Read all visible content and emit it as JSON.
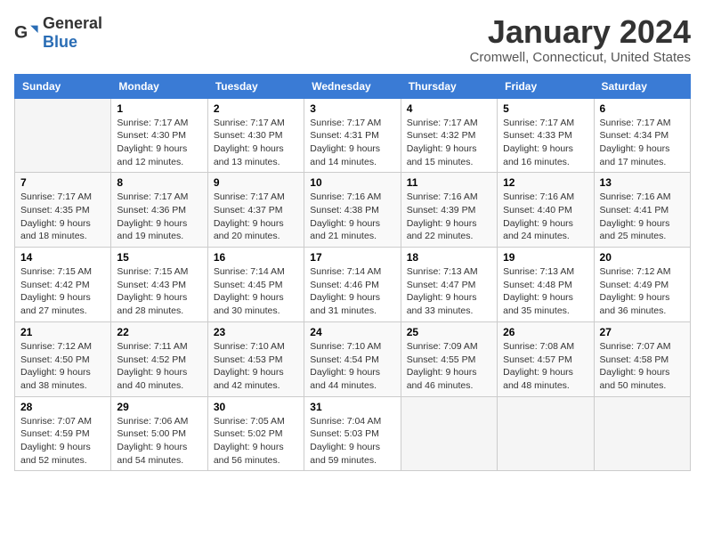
{
  "logo": {
    "text_general": "General",
    "text_blue": "Blue"
  },
  "title": "January 2024",
  "subtitle": "Cromwell, Connecticut, United States",
  "days_of_week": [
    "Sunday",
    "Monday",
    "Tuesday",
    "Wednesday",
    "Thursday",
    "Friday",
    "Saturday"
  ],
  "weeks": [
    [
      {
        "day": "",
        "info": ""
      },
      {
        "day": "1",
        "info": "Sunrise: 7:17 AM\nSunset: 4:30 PM\nDaylight: 9 hours\nand 12 minutes."
      },
      {
        "day": "2",
        "info": "Sunrise: 7:17 AM\nSunset: 4:30 PM\nDaylight: 9 hours\nand 13 minutes."
      },
      {
        "day": "3",
        "info": "Sunrise: 7:17 AM\nSunset: 4:31 PM\nDaylight: 9 hours\nand 14 minutes."
      },
      {
        "day": "4",
        "info": "Sunrise: 7:17 AM\nSunset: 4:32 PM\nDaylight: 9 hours\nand 15 minutes."
      },
      {
        "day": "5",
        "info": "Sunrise: 7:17 AM\nSunset: 4:33 PM\nDaylight: 9 hours\nand 16 minutes."
      },
      {
        "day": "6",
        "info": "Sunrise: 7:17 AM\nSunset: 4:34 PM\nDaylight: 9 hours\nand 17 minutes."
      }
    ],
    [
      {
        "day": "7",
        "info": "Sunrise: 7:17 AM\nSunset: 4:35 PM\nDaylight: 9 hours\nand 18 minutes."
      },
      {
        "day": "8",
        "info": "Sunrise: 7:17 AM\nSunset: 4:36 PM\nDaylight: 9 hours\nand 19 minutes."
      },
      {
        "day": "9",
        "info": "Sunrise: 7:17 AM\nSunset: 4:37 PM\nDaylight: 9 hours\nand 20 minutes."
      },
      {
        "day": "10",
        "info": "Sunrise: 7:16 AM\nSunset: 4:38 PM\nDaylight: 9 hours\nand 21 minutes."
      },
      {
        "day": "11",
        "info": "Sunrise: 7:16 AM\nSunset: 4:39 PM\nDaylight: 9 hours\nand 22 minutes."
      },
      {
        "day": "12",
        "info": "Sunrise: 7:16 AM\nSunset: 4:40 PM\nDaylight: 9 hours\nand 24 minutes."
      },
      {
        "day": "13",
        "info": "Sunrise: 7:16 AM\nSunset: 4:41 PM\nDaylight: 9 hours\nand 25 minutes."
      }
    ],
    [
      {
        "day": "14",
        "info": "Sunrise: 7:15 AM\nSunset: 4:42 PM\nDaylight: 9 hours\nand 27 minutes."
      },
      {
        "day": "15",
        "info": "Sunrise: 7:15 AM\nSunset: 4:43 PM\nDaylight: 9 hours\nand 28 minutes."
      },
      {
        "day": "16",
        "info": "Sunrise: 7:14 AM\nSunset: 4:45 PM\nDaylight: 9 hours\nand 30 minutes."
      },
      {
        "day": "17",
        "info": "Sunrise: 7:14 AM\nSunset: 4:46 PM\nDaylight: 9 hours\nand 31 minutes."
      },
      {
        "day": "18",
        "info": "Sunrise: 7:13 AM\nSunset: 4:47 PM\nDaylight: 9 hours\nand 33 minutes."
      },
      {
        "day": "19",
        "info": "Sunrise: 7:13 AM\nSunset: 4:48 PM\nDaylight: 9 hours\nand 35 minutes."
      },
      {
        "day": "20",
        "info": "Sunrise: 7:12 AM\nSunset: 4:49 PM\nDaylight: 9 hours\nand 36 minutes."
      }
    ],
    [
      {
        "day": "21",
        "info": "Sunrise: 7:12 AM\nSunset: 4:50 PM\nDaylight: 9 hours\nand 38 minutes."
      },
      {
        "day": "22",
        "info": "Sunrise: 7:11 AM\nSunset: 4:52 PM\nDaylight: 9 hours\nand 40 minutes."
      },
      {
        "day": "23",
        "info": "Sunrise: 7:10 AM\nSunset: 4:53 PM\nDaylight: 9 hours\nand 42 minutes."
      },
      {
        "day": "24",
        "info": "Sunrise: 7:10 AM\nSunset: 4:54 PM\nDaylight: 9 hours\nand 44 minutes."
      },
      {
        "day": "25",
        "info": "Sunrise: 7:09 AM\nSunset: 4:55 PM\nDaylight: 9 hours\nand 46 minutes."
      },
      {
        "day": "26",
        "info": "Sunrise: 7:08 AM\nSunset: 4:57 PM\nDaylight: 9 hours\nand 48 minutes."
      },
      {
        "day": "27",
        "info": "Sunrise: 7:07 AM\nSunset: 4:58 PM\nDaylight: 9 hours\nand 50 minutes."
      }
    ],
    [
      {
        "day": "28",
        "info": "Sunrise: 7:07 AM\nSunset: 4:59 PM\nDaylight: 9 hours\nand 52 minutes."
      },
      {
        "day": "29",
        "info": "Sunrise: 7:06 AM\nSunset: 5:00 PM\nDaylight: 9 hours\nand 54 minutes."
      },
      {
        "day": "30",
        "info": "Sunrise: 7:05 AM\nSunset: 5:02 PM\nDaylight: 9 hours\nand 56 minutes."
      },
      {
        "day": "31",
        "info": "Sunrise: 7:04 AM\nSunset: 5:03 PM\nDaylight: 9 hours\nand 59 minutes."
      },
      {
        "day": "",
        "info": ""
      },
      {
        "day": "",
        "info": ""
      },
      {
        "day": "",
        "info": ""
      }
    ]
  ]
}
